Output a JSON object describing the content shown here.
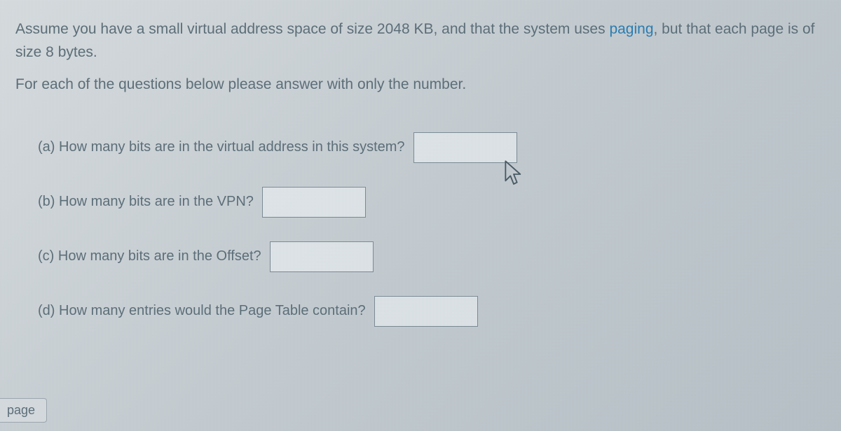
{
  "intro": {
    "part1": "Assume you have a small virtual address space of size 2048 KB, and that the system uses ",
    "link": "paging",
    "part2": ", but that each page is of size 8 bytes."
  },
  "instruction": "For each of the questions below please answer with only the number.",
  "questions": {
    "a": "(a) How many bits are in the virtual address in this system?",
    "b": "(b) How many bits are in the VPN?",
    "c": "(c) How many bits are in the Offset?",
    "d": "(d) How many entries would the Page Table contain?"
  },
  "answers": {
    "a": "",
    "b": "",
    "c": "",
    "d": ""
  },
  "page_label": "page"
}
